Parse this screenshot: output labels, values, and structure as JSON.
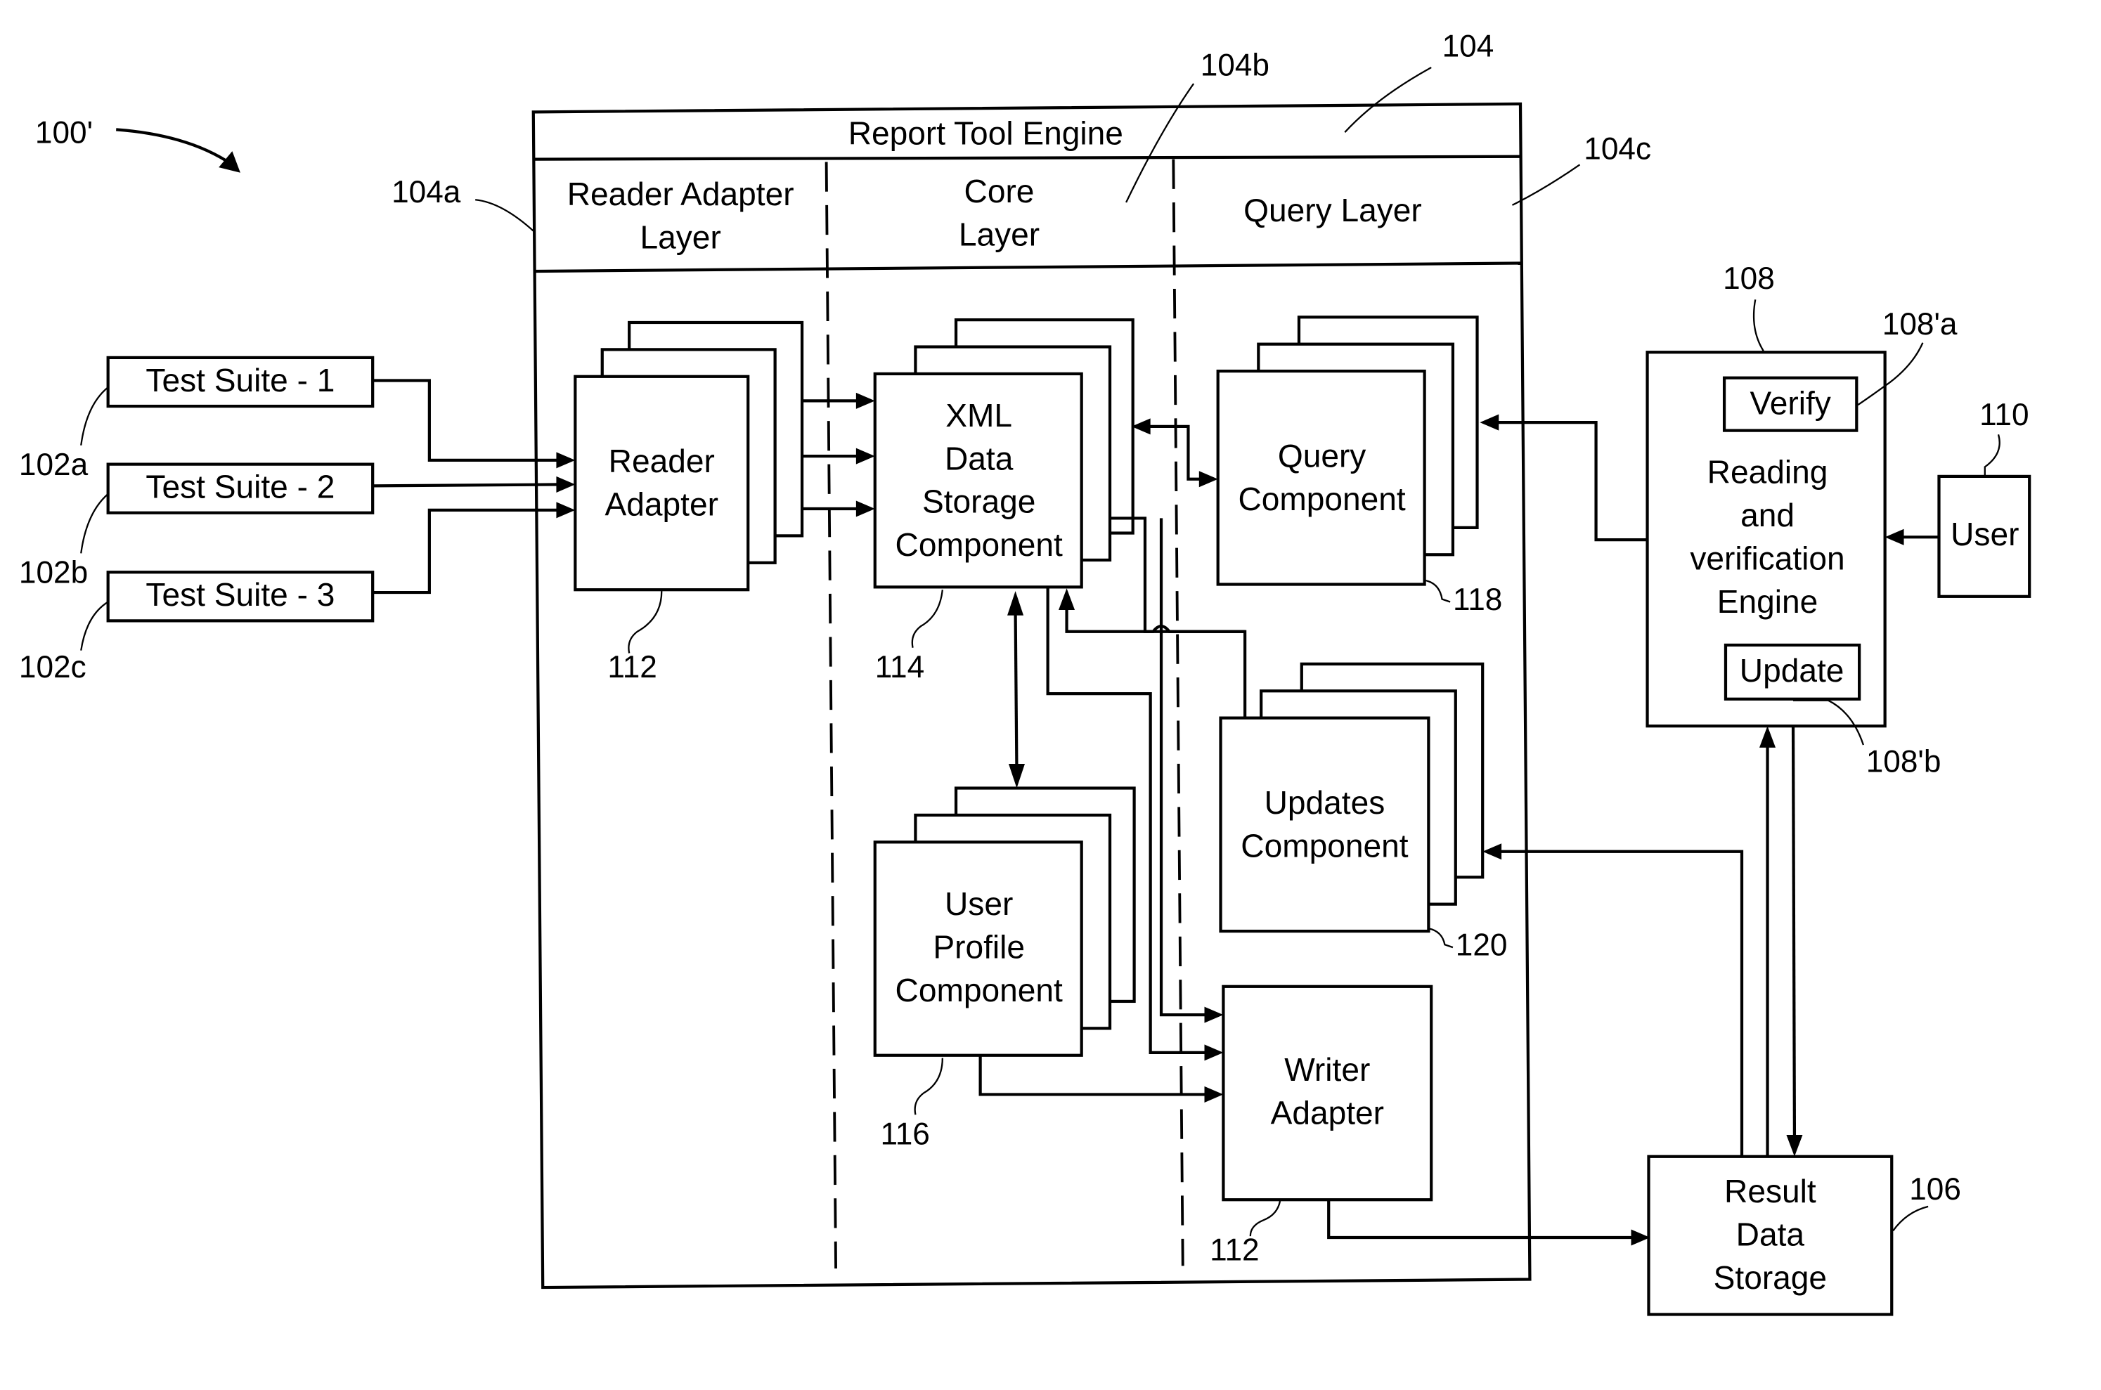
{
  "figure_ref": "100'",
  "engine": {
    "title": "Report Tool Engine",
    "ref": "104",
    "layers": [
      {
        "ref": "104a",
        "label_lines": [
          "Reader Adapter",
          "Layer"
        ]
      },
      {
        "ref": "104b",
        "label_lines": [
          "Core",
          "Layer"
        ]
      },
      {
        "ref": "104c",
        "label_lines": [
          "Query Layer"
        ]
      }
    ]
  },
  "test_suites": [
    {
      "label": "Test Suite - 1",
      "ref": "102a"
    },
    {
      "label": "Test Suite - 2",
      "ref": "102b"
    },
    {
      "label": "Test Suite - 3",
      "ref": "102c"
    }
  ],
  "components": {
    "reader_adapter": {
      "label_lines": [
        "Reader",
        "Adapter"
      ],
      "ref": "112"
    },
    "xml_storage": {
      "label_lines": [
        "XML",
        "Data",
        "Storage",
        "Component"
      ],
      "ref": "114"
    },
    "user_profile": {
      "label_lines": [
        "User",
        "Profile",
        "Component"
      ],
      "ref": "116"
    },
    "query": {
      "label_lines": [
        "Query",
        "Component"
      ],
      "ref": "118"
    },
    "updates": {
      "label_lines": [
        "Updates",
        "Component"
      ],
      "ref": "120"
    },
    "writer_adapter": {
      "label_lines": [
        "Writer",
        "Adapter"
      ],
      "ref": "112"
    }
  },
  "rv_engine": {
    "label_lines": [
      "Reading",
      "and",
      "verification",
      "Engine"
    ],
    "ref": "108",
    "verify": {
      "label": "Verify",
      "ref": "108'a"
    },
    "update": {
      "label": "Update",
      "ref": "108'b"
    }
  },
  "user": {
    "label": "User",
    "ref": "110"
  },
  "result_storage": {
    "label_lines": [
      "Result",
      "Data",
      "Storage"
    ],
    "ref": "106"
  }
}
